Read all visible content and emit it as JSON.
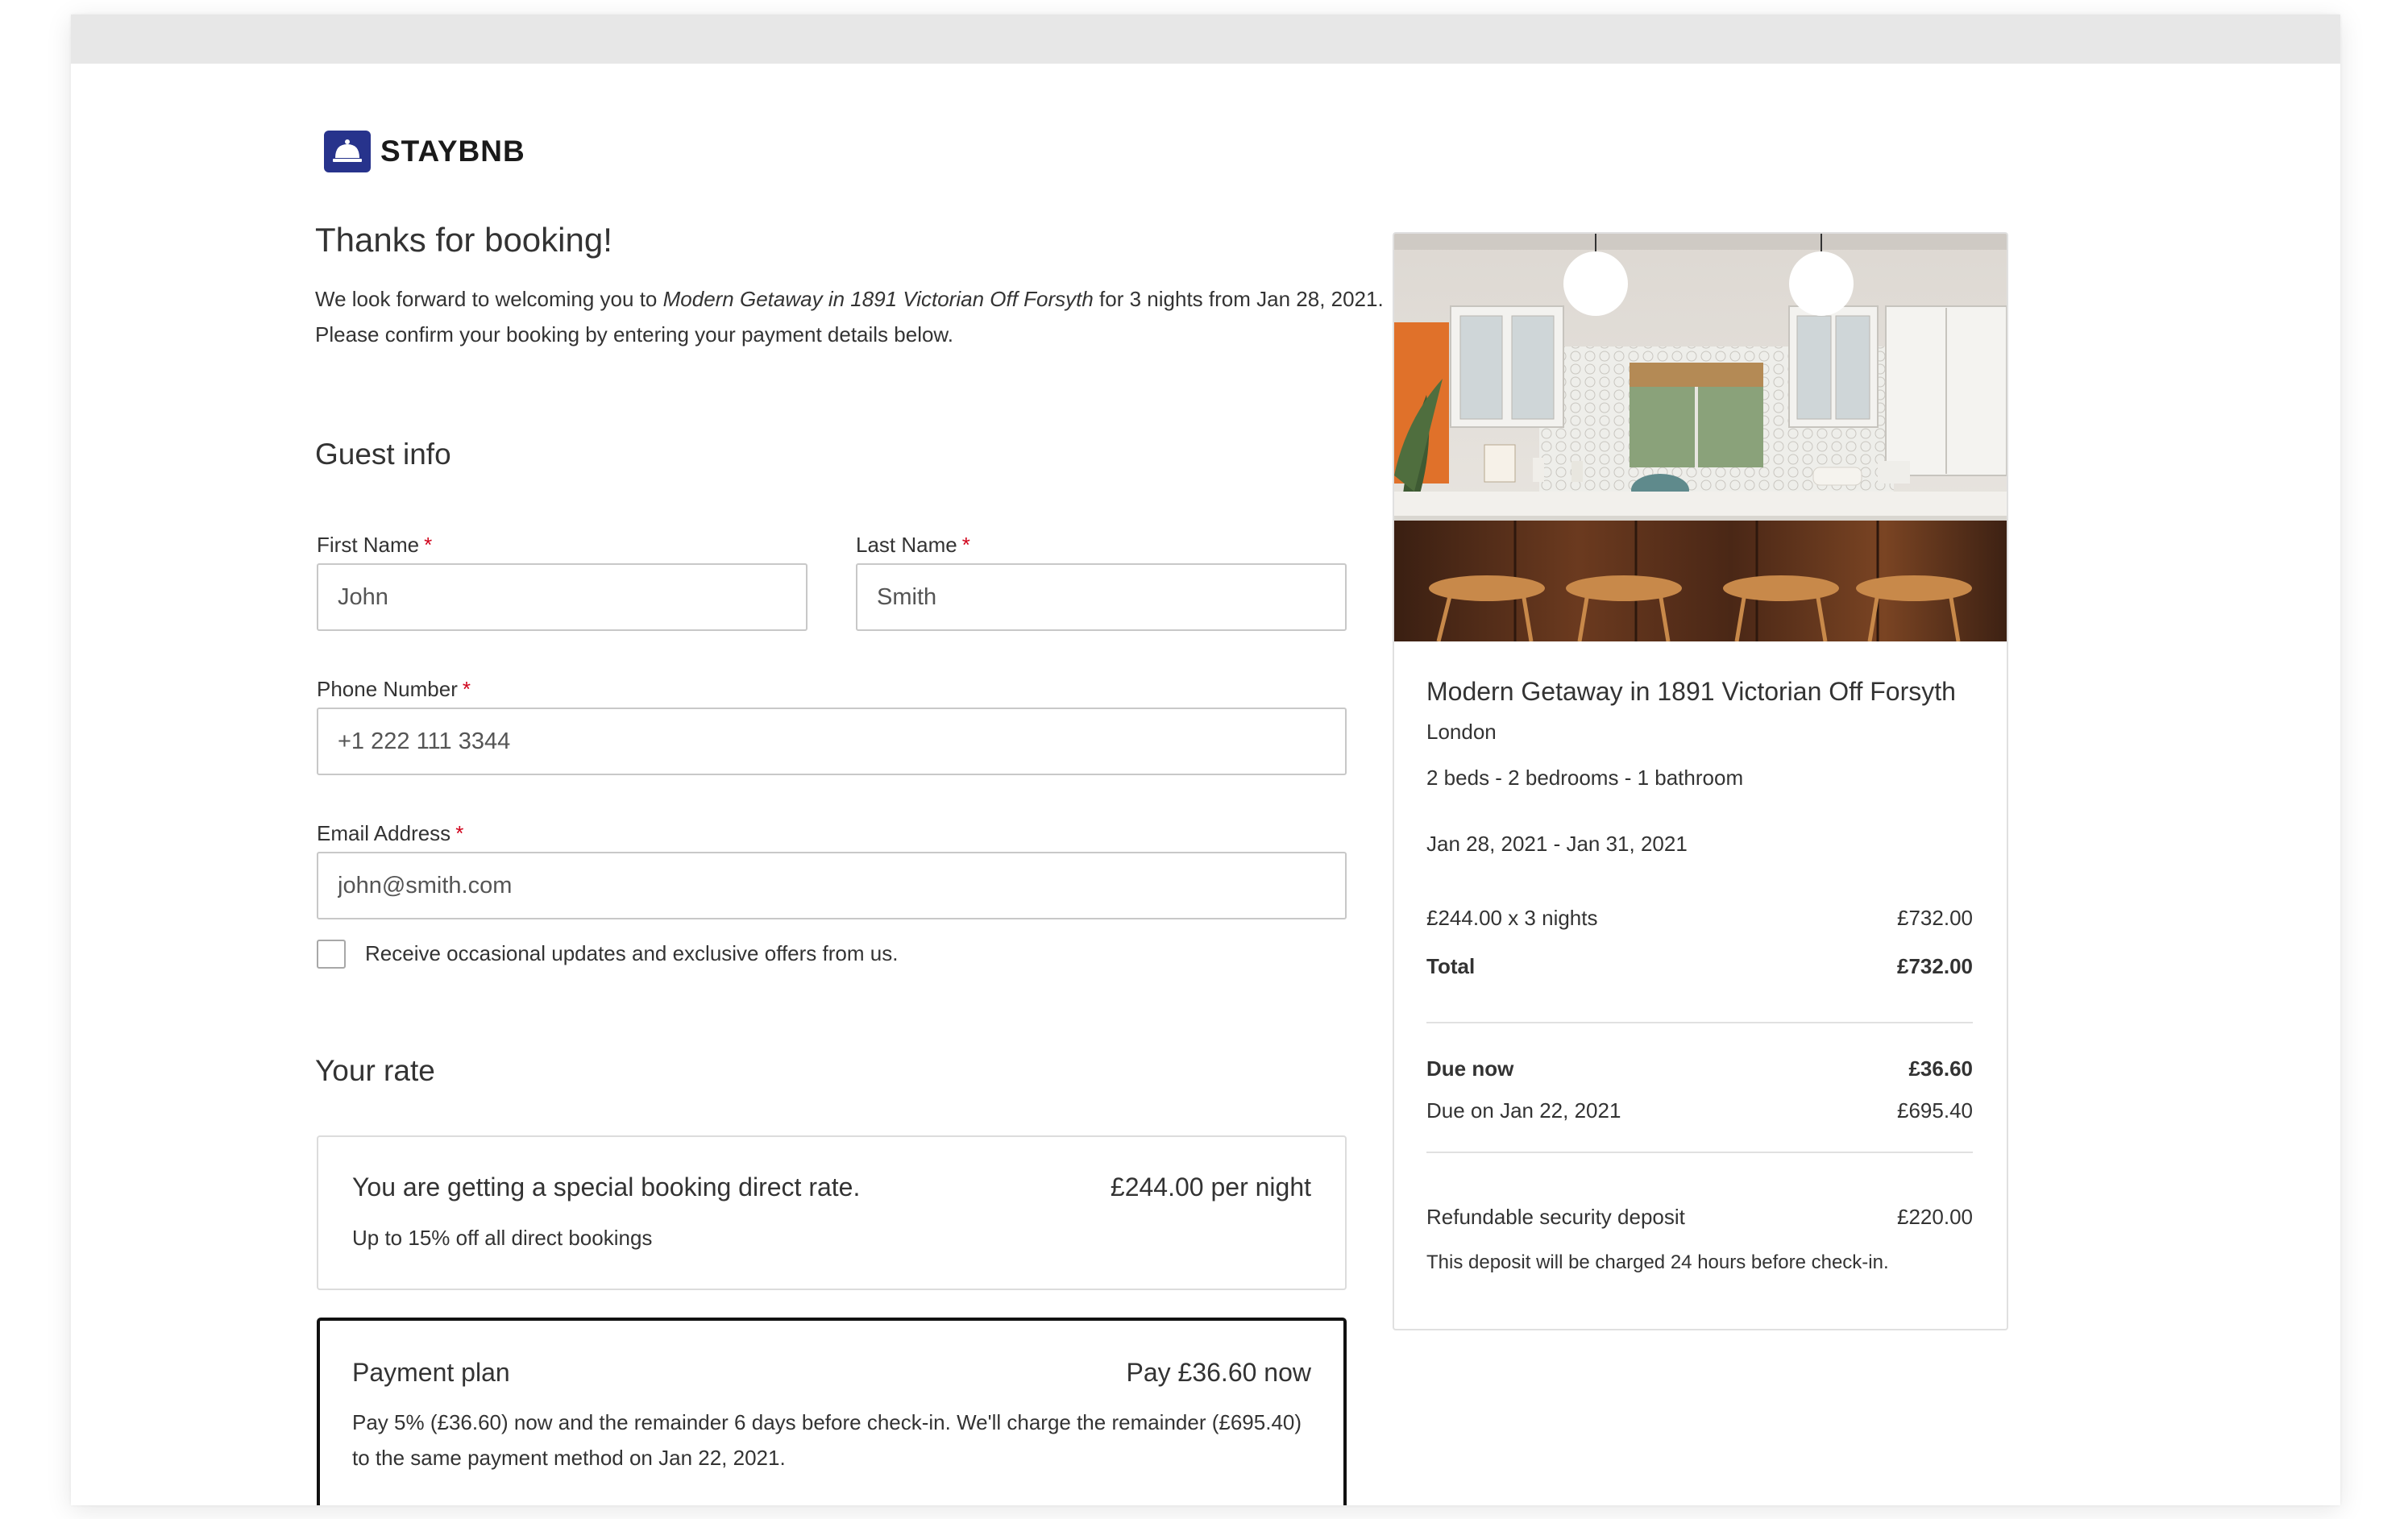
{
  "brand": {
    "name": "STAYBNB",
    "icon": "bell-icon",
    "color": "#27338c"
  },
  "header": {
    "title": "Thanks for booking!",
    "intro_before": "We look forward to welcoming you to ",
    "intro_property": "Modern Getaway in 1891 Victorian Off Forsyth",
    "intro_after": " for 3 nights from Jan 28, 2021. Please confirm your booking by entering your payment details below."
  },
  "guest_info": {
    "heading": "Guest info",
    "first_name": {
      "label": "First Name",
      "required": "*",
      "value": "John"
    },
    "last_name": {
      "label": "Last Name",
      "required": "*",
      "value": "Smith"
    },
    "phone": {
      "label": "Phone Number",
      "required": "*",
      "value": "+1 222 111 3344"
    },
    "email": {
      "label": "Email Address",
      "required": "*",
      "value": "john@smith.com"
    },
    "updates_checkbox": {
      "label": "Receive occasional updates and exclusive offers from us.",
      "checked": false
    }
  },
  "rate": {
    "heading": "Your rate",
    "title": "You are getting a special booking direct rate.",
    "price": "£244.00 per night",
    "subtitle": "Up to 15% off all direct bookings"
  },
  "payment_plan": {
    "title": "Payment plan",
    "price": "Pay £36.60 now",
    "description": "Pay 5% (£36.60) now and the remainder 6 days before check-in. We'll charge the remainder (£695.40) to the same payment method on Jan 22, 2021."
  },
  "summary": {
    "property": "Modern Getaway in 1891 Victorian Off Forsyth",
    "location": "London",
    "features": "2 beds - 2 bedrooms - 1 bathroom",
    "dates": "Jan 28, 2021 - Jan 31, 2021",
    "nightly_label": "£244.00 x 3 nights",
    "nightly_value": "£732.00",
    "total_label": "Total",
    "total_value": "£732.00",
    "due_now_label": "Due now",
    "due_now_value": "£36.60",
    "due_later_label": "Due on Jan 22, 2021",
    "due_later_value": "£695.40",
    "deposit_label": "Refundable security deposit",
    "deposit_value": "£220.00",
    "deposit_note": "This deposit will be charged 24 hours before check-in."
  },
  "colors": {
    "required": "#d0021b",
    "border": "#c8c8c8",
    "plan_border": "#111111"
  }
}
